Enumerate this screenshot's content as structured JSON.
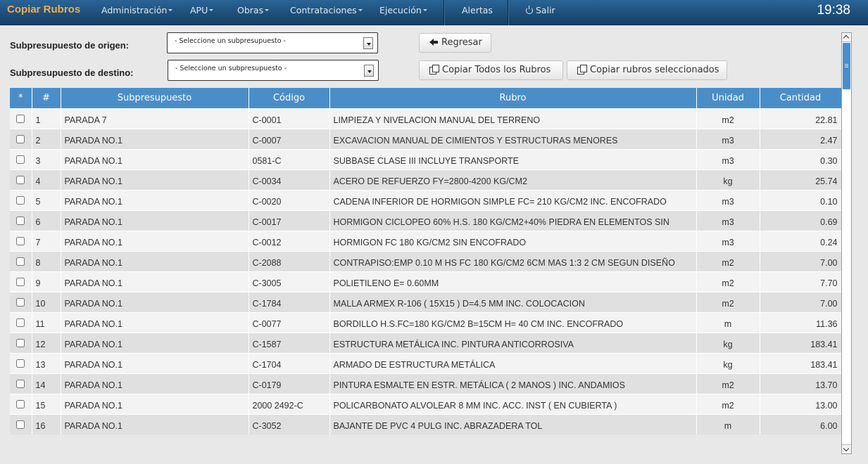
{
  "nav": {
    "brand": "Copiar Rubros",
    "menu": [
      {
        "label": "Administración"
      },
      {
        "label": "APU"
      },
      {
        "label": "Obras"
      },
      {
        "label": "Contrataciones"
      },
      {
        "label": "Ejecución"
      }
    ],
    "alerts": "Alertas",
    "logout": "Salir",
    "clock": "19:38"
  },
  "form": {
    "origin_label": "Subpresupuesto de origen:",
    "origin_select": "- Seleccione un subpresupuesto -",
    "dest_label": "Subpresupuesto de destino:",
    "dest_select": "- Seleccione un subpresupuesto -",
    "back_button": "Regresar",
    "copy_all_button": "Copiar Todos los Rubros",
    "copy_selected_button": "Copiar rubros seleccionados"
  },
  "table": {
    "columns": [
      "*",
      "#",
      "Subpresupuesto",
      "Código",
      "Rubro",
      "Unidad",
      "Cantidad"
    ],
    "rows": [
      {
        "n": "1",
        "sub": "PARADA 7",
        "code": "C-0001",
        "rubro": "LIMPIEZA Y NIVELACION MANUAL DEL TERRENO",
        "unit": "m2",
        "qty": "22.81"
      },
      {
        "n": "2",
        "sub": "PARADA NO.1",
        "code": "C-0007",
        "rubro": "EXCAVACION MANUAL DE CIMIENTOS Y ESTRUCTURAS MENORES",
        "unit": "m3",
        "qty": "2.47"
      },
      {
        "n": "3",
        "sub": "PARADA NO.1",
        "code": "0581-C",
        "rubro": "SUBBASE CLASE III INCLUYE TRANSPORTE",
        "unit": "m3",
        "qty": "0.30"
      },
      {
        "n": "4",
        "sub": "PARADA NO.1",
        "code": "C-0034",
        "rubro": "ACERO DE REFUERZO FY=2800-4200 KG/CM2",
        "unit": "kg",
        "qty": "25.74"
      },
      {
        "n": "5",
        "sub": "PARADA NO.1",
        "code": "C-0020",
        "rubro": "CADENA INFERIOR DE HORMIGON SIMPLE FC= 210 KG/CM2 INC. ENCOFRADO",
        "unit": "m3",
        "qty": "0.10"
      },
      {
        "n": "6",
        "sub": "PARADA NO.1",
        "code": "C-0017",
        "rubro": "HORMIGON CICLOPEO 60% H.S. 180 KG/CM2+40% PIEDRA EN ELEMENTOS SIN",
        "unit": "m3",
        "qty": "0.69"
      },
      {
        "n": "7",
        "sub": "PARADA NO.1",
        "code": "C-0012",
        "rubro": "HORMIGON FC 180 KG/CM2 SIN ENCOFRADO",
        "unit": "m3",
        "qty": "0.24"
      },
      {
        "n": "8",
        "sub": "PARADA NO.1",
        "code": "C-2088",
        "rubro": "CONTRAPISO:EMP 0.10 M HS FC 180 KG/CM2 6CM MAS 1:3 2 CM SEGUN DISEÑO",
        "unit": "m2",
        "qty": "7.00"
      },
      {
        "n": "9",
        "sub": "PARADA NO.1",
        "code": "C-3005",
        "rubro": "POLIETILENO E= 0.60MM",
        "unit": "m2",
        "qty": "7.70"
      },
      {
        "n": "10",
        "sub": "PARADA NO.1",
        "code": "C-1784",
        "rubro": "MALLA ARMEX R-106 ( 15X15 ) D=4.5 MM INC. COLOCACION",
        "unit": "m2",
        "qty": "7.00"
      },
      {
        "n": "11",
        "sub": "PARADA NO.1",
        "code": "C-0077",
        "rubro": "BORDILLO H.S.FC=180 KG/CM2 B=15CM H= 40 CM INC. ENCOFRADO",
        "unit": "m",
        "qty": "11.36"
      },
      {
        "n": "12",
        "sub": "PARADA NO.1",
        "code": "C-1587",
        "rubro": "ESTRUCTURA METÁLICA INC. PINTURA ANTICORROSIVA",
        "unit": "kg",
        "qty": "183.41"
      },
      {
        "n": "13",
        "sub": "PARADA NO.1",
        "code": "C-1704",
        "rubro": "ARMADO DE ESTRUCTURA METÁLICA",
        "unit": "kg",
        "qty": "183.41"
      },
      {
        "n": "14",
        "sub": "PARADA NO.1",
        "code": "C-0179",
        "rubro": "PINTURA ESMALTE EN ESTR. METÁLICA ( 2 MANOS ) INC. ANDAMIOS",
        "unit": "m2",
        "qty": "13.70"
      },
      {
        "n": "15",
        "sub": "PARADA NO.1",
        "code": "2000 2492-C",
        "rubro": "POLICARBONATO ALVOLEAR 8 MM INC. ACC. INST ( EN CUBIERTA )",
        "unit": "m2",
        "qty": "13.00"
      },
      {
        "n": "16",
        "sub": "PARADA NO.1",
        "code": "C-3052",
        "rubro": "BAJANTE DE PVC 4 PULG INC. ABRAZADERA TOL",
        "unit": "m",
        "qty": "6.00"
      }
    ]
  }
}
